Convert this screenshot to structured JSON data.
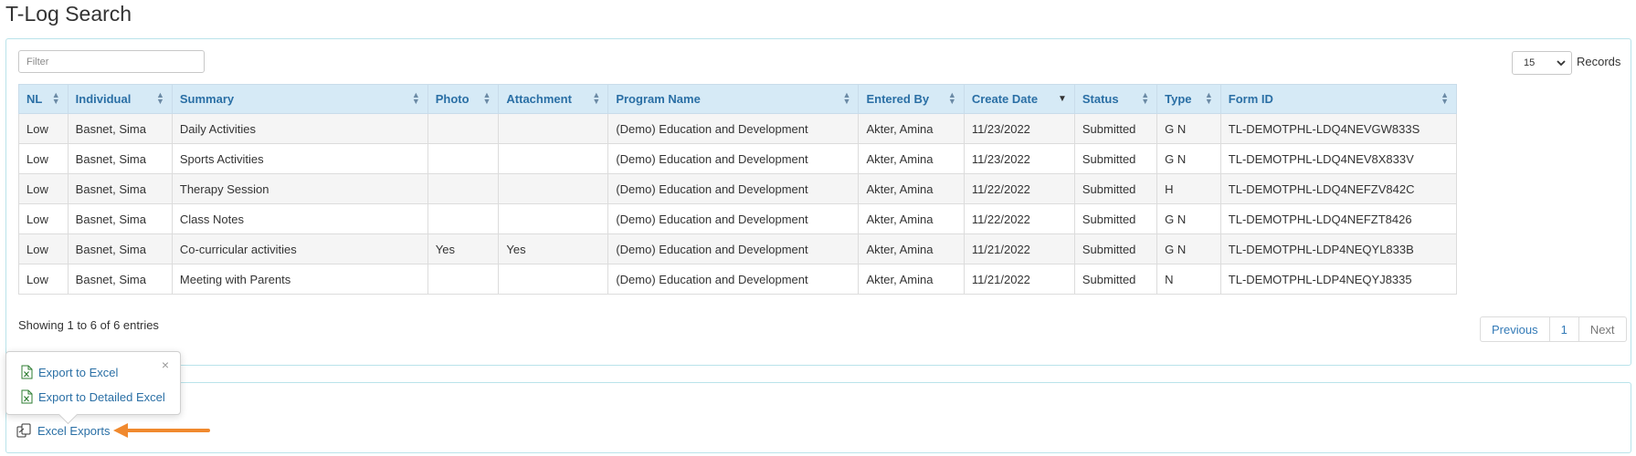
{
  "page": {
    "title": "T-Log Search"
  },
  "filter": {
    "placeholder": "Filter",
    "value": ""
  },
  "records": {
    "selected": "15",
    "label": "Records"
  },
  "table": {
    "columns": [
      "NL",
      "Individual",
      "Summary",
      "Photo",
      "Attachment",
      "Program Name",
      "Entered By",
      "Create Date",
      "Status",
      "Type",
      "Form ID"
    ],
    "sorted_column": "Create Date",
    "sort_direction": "desc",
    "rows": [
      [
        "Low",
        "Basnet, Sima",
        "Daily Activities",
        "",
        "",
        "(Demo) Education and Development",
        "Akter, Amina",
        "11/23/2022",
        "Submitted",
        "G N",
        "TL-DEMOTPHL-LDQ4NEVGW833S"
      ],
      [
        "Low",
        "Basnet, Sima",
        "Sports Activities",
        "",
        "",
        "(Demo) Education and Development",
        "Akter, Amina",
        "11/23/2022",
        "Submitted",
        "G N",
        "TL-DEMOTPHL-LDQ4NEV8X833V"
      ],
      [
        "Low",
        "Basnet, Sima",
        "Therapy Session",
        "",
        "",
        "(Demo) Education and Development",
        "Akter, Amina",
        "11/22/2022",
        "Submitted",
        "H",
        "TL-DEMOTPHL-LDQ4NEFZV842C"
      ],
      [
        "Low",
        "Basnet, Sima",
        "Class Notes",
        "",
        "",
        "(Demo) Education and Development",
        "Akter, Amina",
        "11/22/2022",
        "Submitted",
        "G N",
        "TL-DEMOTPHL-LDQ4NEFZT8426"
      ],
      [
        "Low",
        "Basnet, Sima",
        "Co-curricular activities",
        "Yes",
        "Yes",
        "(Demo) Education and Development",
        "Akter, Amina",
        "11/21/2022",
        "Submitted",
        "G N",
        "TL-DEMOTPHL-LDP4NEQYL833B"
      ],
      [
        "Low",
        "Basnet, Sima",
        "Meeting with Parents",
        "",
        "",
        "(Demo) Education and Development",
        "Akter, Amina",
        "11/21/2022",
        "Submitted",
        "N",
        "TL-DEMOTPHL-LDP4NEQYJ8335"
      ]
    ]
  },
  "footer": {
    "showing": "Showing 1 to 6 of 6 entries"
  },
  "pagination": {
    "previous": "Previous",
    "page": "1",
    "next": "Next"
  },
  "exports": {
    "popover_close": "×",
    "export_to_excel": "Export to Excel",
    "export_to_detailed_excel": "Export to Detailed Excel",
    "excel_exports": "Excel Exports"
  },
  "colors": {
    "link": "#2a6fa5",
    "header_bg": "#d6eaf6",
    "panel_border": "#b9e3ea",
    "arrow": "#f0892e",
    "excel_green": "#2e7d32"
  },
  "icons": {
    "excel_file": "excel-file-icon",
    "copy": "copy-icon",
    "sort": "sort-icon",
    "chevron": "chevron-down-icon"
  }
}
